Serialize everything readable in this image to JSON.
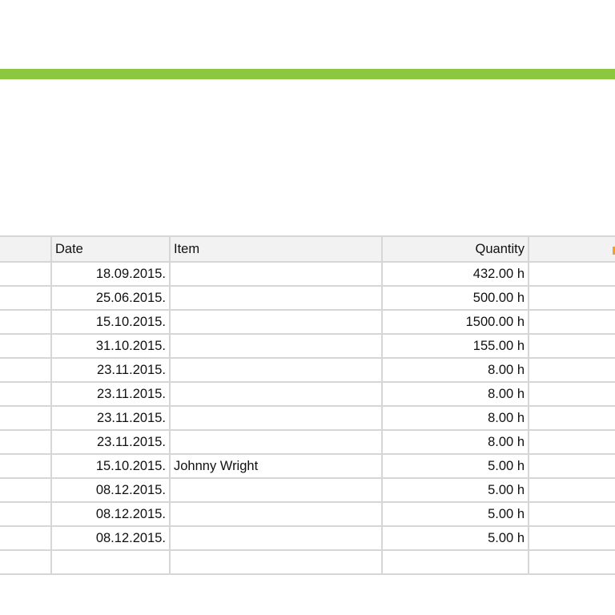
{
  "accent_color": "#8dc63f",
  "table": {
    "headers": {
      "group": "",
      "date": "Date",
      "item": "Item",
      "quantity": "Quantity",
      "extra": ""
    },
    "rows": [
      {
        "date": "18.09.2015.",
        "item": "",
        "quantity": "432.00 h"
      },
      {
        "date": "25.06.2015.",
        "item": "",
        "quantity": "500.00 h"
      },
      {
        "date": "15.10.2015.",
        "item": "",
        "quantity": "1500.00 h"
      },
      {
        "date": "31.10.2015.",
        "item": "",
        "quantity": "155.00 h"
      },
      {
        "date": "23.11.2015.",
        "item": "",
        "quantity": "8.00 h"
      },
      {
        "date": "23.11.2015.",
        "item": "",
        "quantity": "8.00 h"
      },
      {
        "date": "23.11.2015.",
        "item": "",
        "quantity": "8.00 h"
      },
      {
        "date": "23.11.2015.",
        "item": "",
        "quantity": "8.00 h"
      },
      {
        "date": "15.10.2015.",
        "item": "Johnny Wright",
        "quantity": "5.00 h"
      },
      {
        "date": "08.12.2015.",
        "item": "",
        "quantity": "5.00 h"
      },
      {
        "date": "08.12.2015.",
        "item": "",
        "quantity": "5.00 h"
      },
      {
        "date": "08.12.2015.",
        "item": "",
        "quantity": "5.00 h"
      }
    ]
  }
}
